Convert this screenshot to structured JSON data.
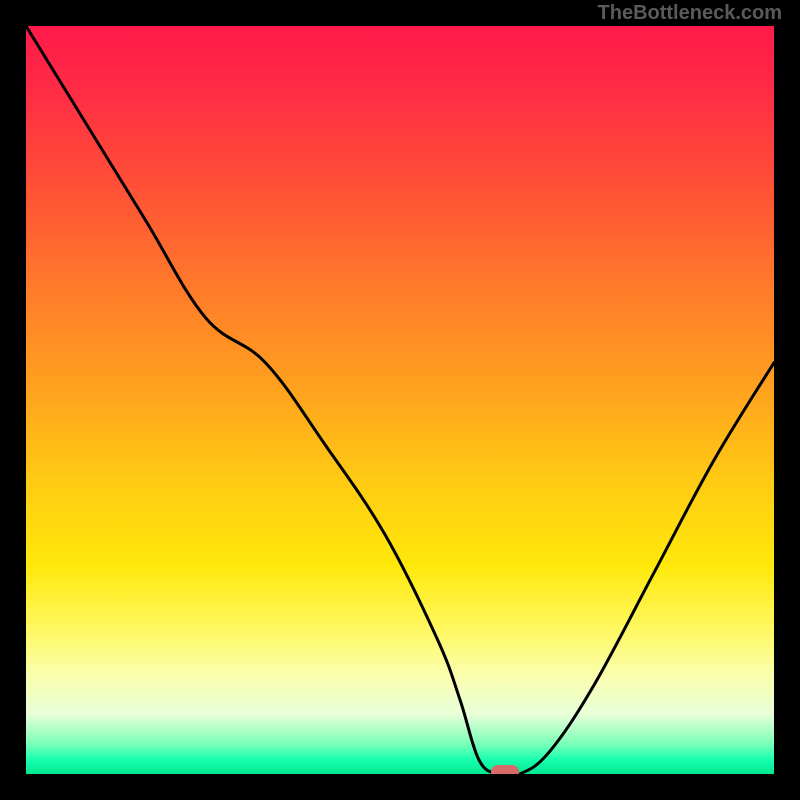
{
  "watermark": "TheBottleneck.com",
  "chart_data": {
    "type": "line",
    "title": "",
    "xlabel": "",
    "ylabel": "",
    "xlim": [
      0,
      100
    ],
    "ylim": [
      0,
      100
    ],
    "x": [
      0,
      8,
      16,
      24,
      32,
      40,
      48,
      55,
      58,
      60.5,
      63,
      66,
      70,
      76,
      84,
      92,
      100
    ],
    "values": [
      100,
      87,
      74,
      61,
      55,
      44,
      32,
      18,
      10,
      2,
      0,
      0,
      3,
      12,
      27,
      42,
      55
    ],
    "marker": {
      "x": 64,
      "y": 0
    },
    "gradient_stops": [
      {
        "pos": 0.0,
        "color": "#ff1a4a"
      },
      {
        "pos": 0.35,
        "color": "#ff7a2a"
      },
      {
        "pos": 0.72,
        "color": "#ffe80a"
      },
      {
        "pos": 0.92,
        "color": "#e8ffd8"
      },
      {
        "pos": 1.0,
        "color": "#00e890"
      }
    ]
  }
}
